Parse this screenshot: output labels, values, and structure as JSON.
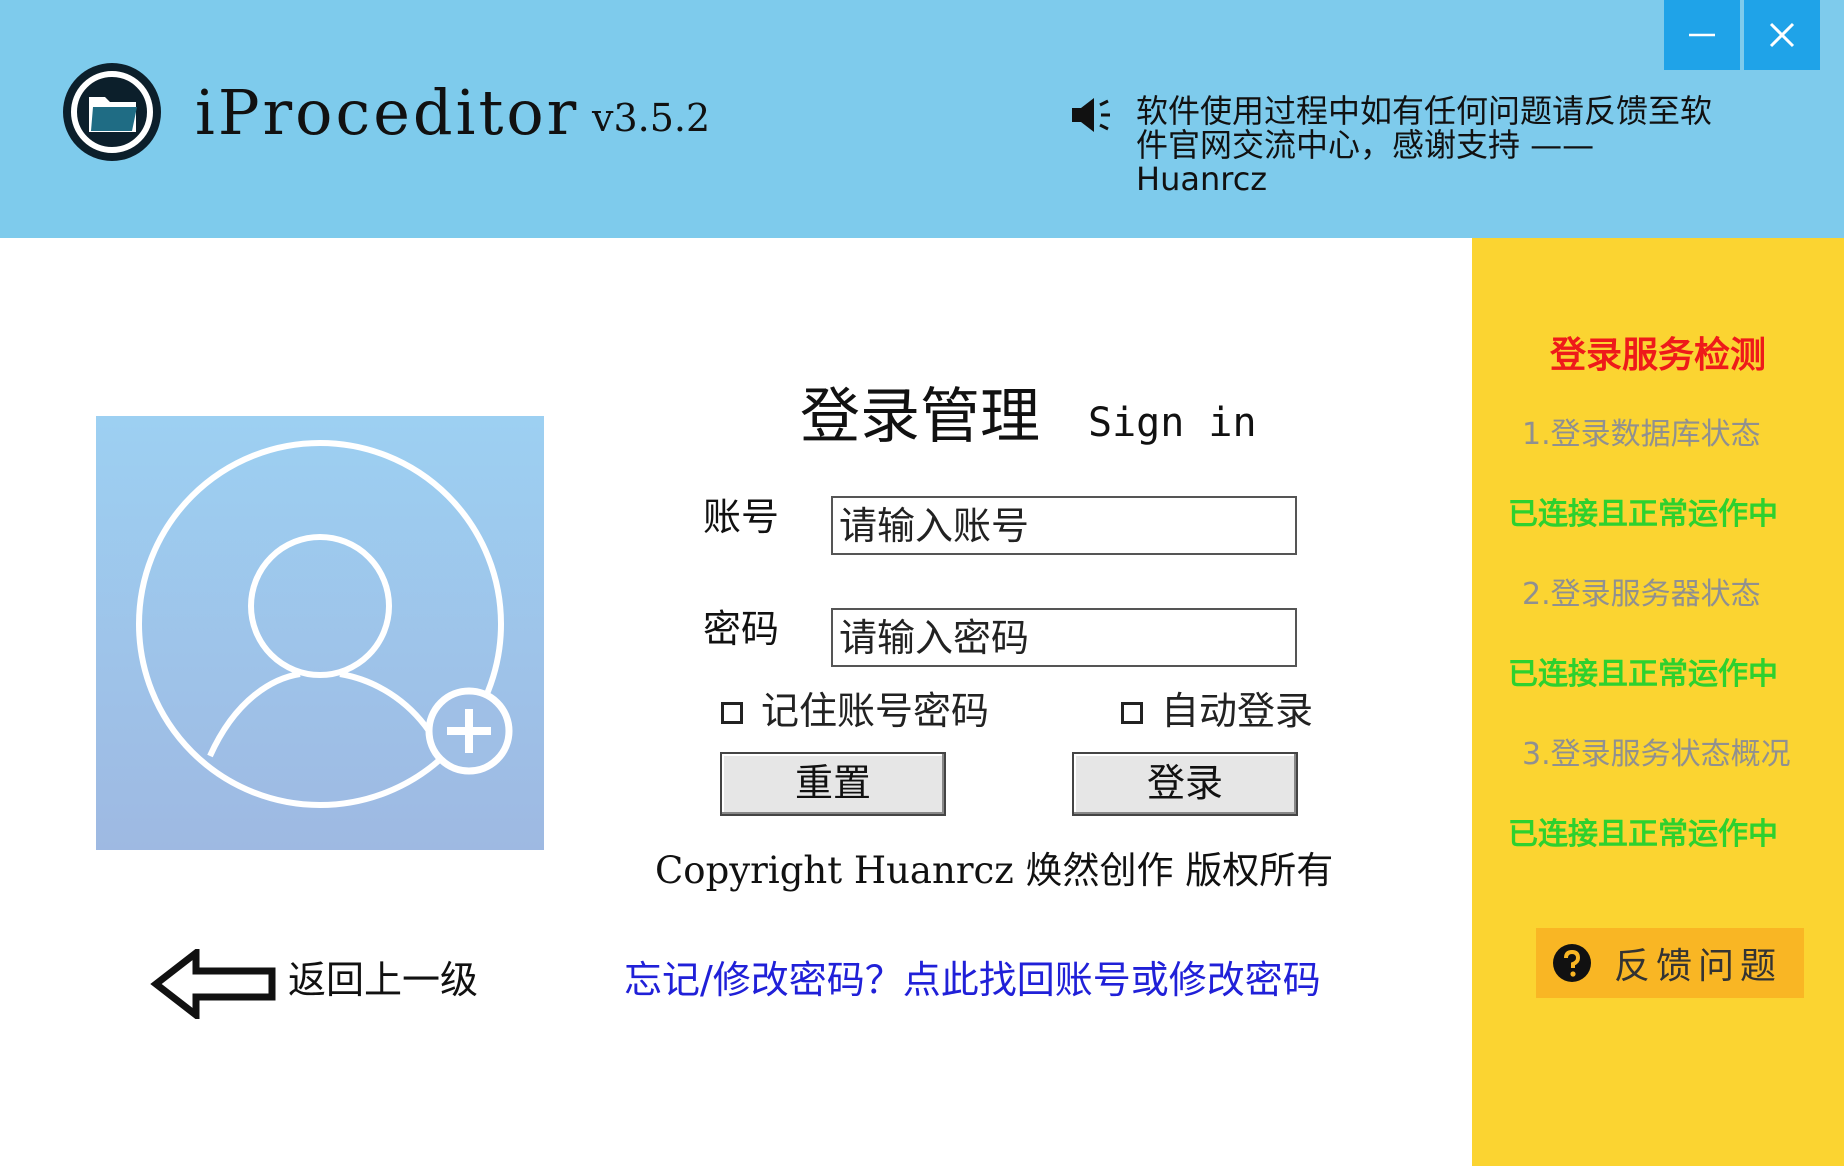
{
  "header": {
    "title": "iProceditor",
    "version": "v3.5.2",
    "notice": "软件使用过程中如有任何问题请反馈至软件官网交流中心，感谢支持 ——Huanrcz",
    "icons": [
      "folder-icon",
      "speaker-icon",
      "minimize-icon",
      "close-icon"
    ]
  },
  "login": {
    "heading": "登录管理",
    "heading_sub": "Sign in",
    "account_label": "账号",
    "account_placeholder": "请输入账号",
    "password_label": "密码",
    "password_placeholder": "请输入密码",
    "remember_label": "记住账号密码",
    "auto_login_label": "自动登录",
    "reset_label": "重置",
    "login_label": "登录",
    "copyright": "Copyright Huanrcz 焕然创作 版权所有",
    "back_label": "返回上一级",
    "forgot_link": "忘记/修改密码？点此找回账号或修改密码"
  },
  "sidebar": {
    "title": "登录服务检测",
    "items": [
      {
        "label": "1.登录数据库状态",
        "status": "已连接且正常运作中"
      },
      {
        "label": "2.登录服务器状态",
        "status": "已连接且正常运作中"
      },
      {
        "label": "3.登录服务状态概况",
        "status": "已连接且正常运作中"
      }
    ],
    "feedback_label": "反馈问题"
  },
  "colors": {
    "header_bg": "#7ecbec",
    "window_button": "#1fa3e8",
    "sidebar_bg": "#fbd431",
    "sidebar_title": "#ee1a1a",
    "status_ok": "#2ed12e",
    "link": "#2020d8",
    "feedback_bg": "#f9b624"
  }
}
